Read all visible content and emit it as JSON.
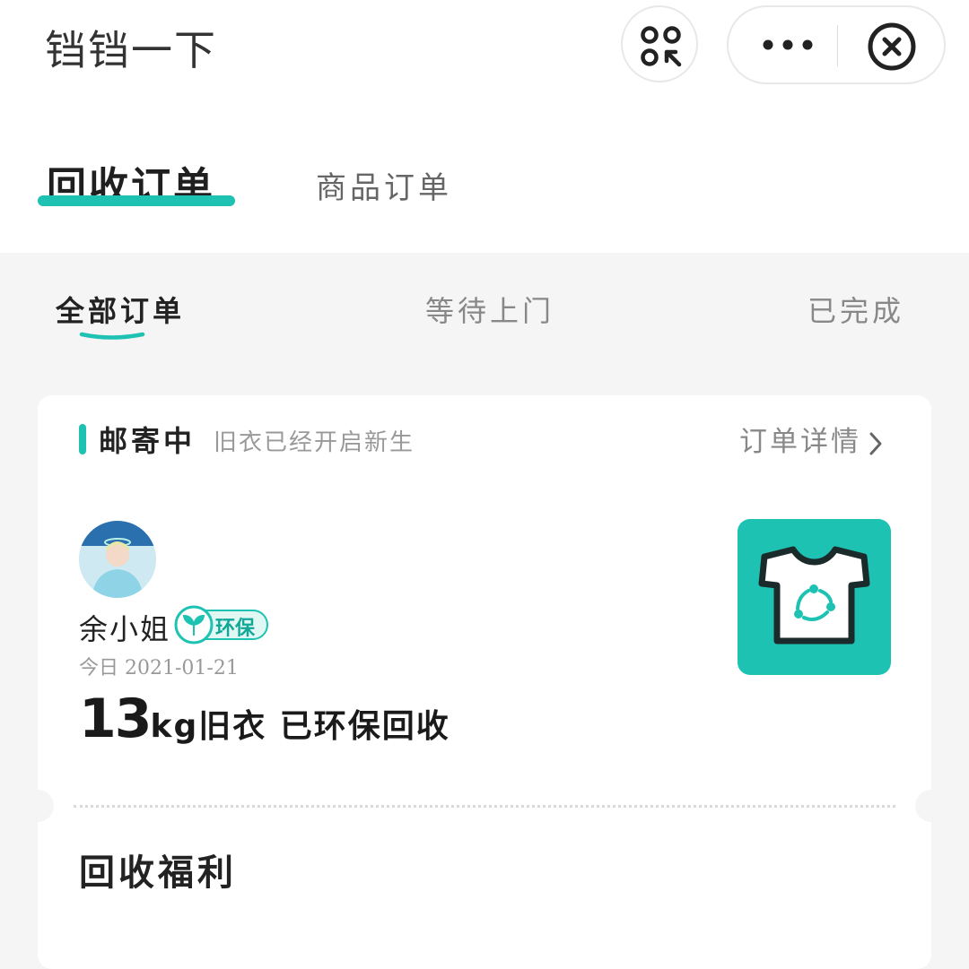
{
  "app": {
    "title": "铛铛一下"
  },
  "capsule": {
    "more_icon": "more-dots-icon",
    "close_icon": "close-circle-icon"
  },
  "main_tabs": [
    {
      "label": "回收订单",
      "active": true
    },
    {
      "label": "商品订单",
      "active": false
    }
  ],
  "sub_tabs": [
    {
      "label": "全部订单",
      "active": true
    },
    {
      "label": "等待上门",
      "active": false
    },
    {
      "label": "已完成",
      "active": false
    }
  ],
  "order": {
    "status": "邮寄中",
    "status_desc": "旧衣已经开启新生",
    "detail_link": "订单详情",
    "user_name": "余小姐",
    "badge": "环保",
    "date": "今日 2021-01-21",
    "weight_value": "13",
    "weight_text": "kg旧衣 已环保回收"
  },
  "benefits": {
    "title": "回收福利"
  },
  "colors": {
    "accent": "#1ec2b2",
    "background": "#f5f5f5"
  }
}
